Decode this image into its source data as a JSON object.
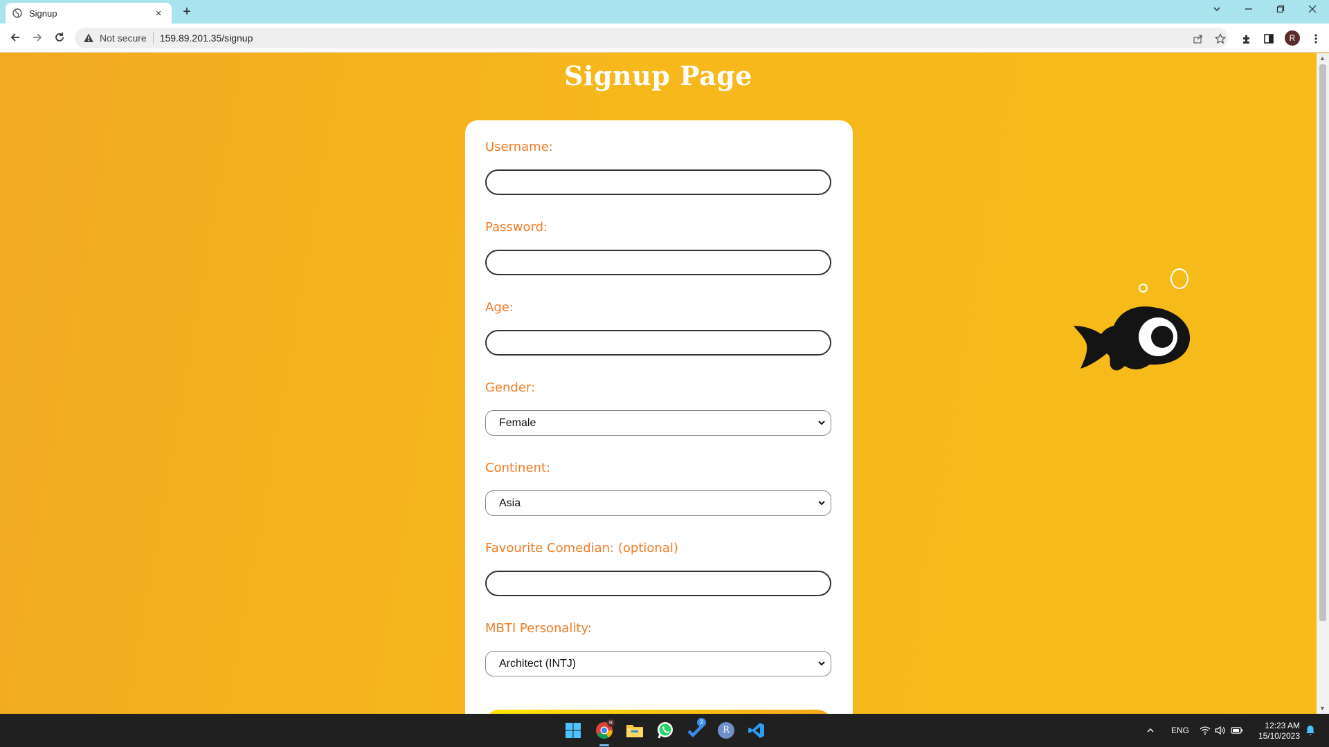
{
  "browser": {
    "tab_title": "Signup",
    "new_tab": "+",
    "tab_close": "×",
    "security_label": "Not secure",
    "url": "159.89.201.35/signup",
    "profile_initial": "R",
    "window_controls": [
      "chevron-down-icon",
      "minimize-icon",
      "restore-icon",
      "close-icon"
    ]
  },
  "page": {
    "heading": "Signup Page",
    "form": {
      "username_label": "Username:",
      "username_value": "",
      "password_label": "Password:",
      "password_value": "",
      "age_label": "Age:",
      "age_value": "",
      "gender_label": "Gender:",
      "gender_selected": "Female",
      "continent_label": "Continent:",
      "continent_selected": "Asia",
      "comedian_label": "Favourite Comedian: (optional)",
      "comedian_value": "",
      "mbti_label": "MBTI Personality:",
      "mbti_selected": "Architect (INTJ)"
    }
  },
  "taskbar": {
    "apps": [
      "windows-start-icon",
      "chrome-icon",
      "file-explorer-icon",
      "whatsapp-icon",
      "todo-app-icon",
      "r-app-icon",
      "vscode-icon"
    ],
    "todo_badge": "2",
    "chrome_badge": "R",
    "r_app_letter": "R",
    "language": "ENG",
    "time": "12:23 AM",
    "date": "15/10/2023"
  },
  "colors": {
    "background": "#f5b51e",
    "label": "#f07c23",
    "tabbar": "#a8e3ee",
    "taskbar": "#202020"
  }
}
